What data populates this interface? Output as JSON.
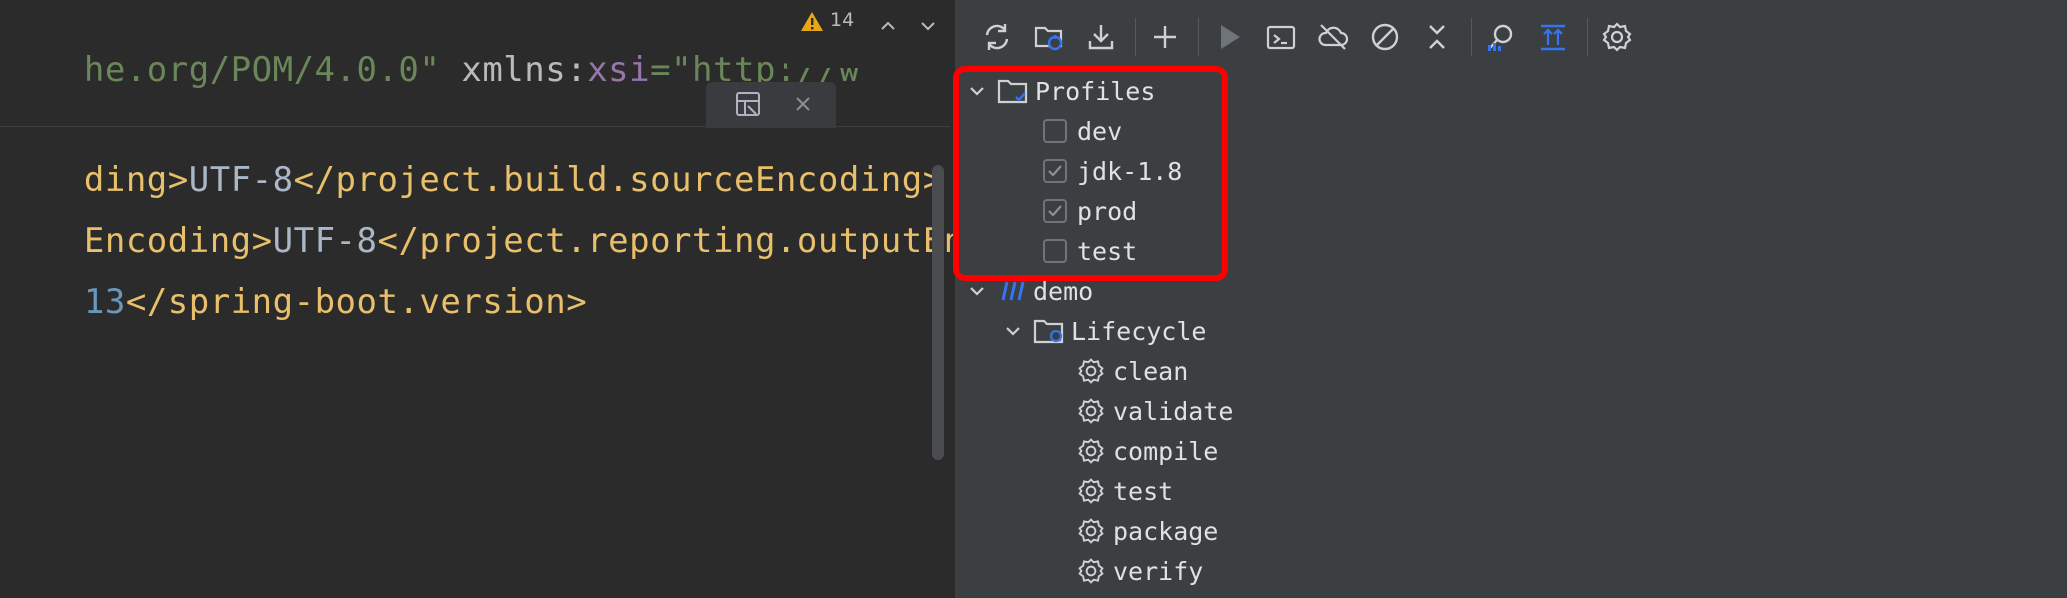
{
  "editor": {
    "line1": {
      "a": "he.org/POM/4.0.0\"",
      "b": " xmlns:",
      "c": "xsi",
      "d": "=\"http://w"
    },
    "line2": {
      "a": "ding>",
      "b": "UTF-8",
      "c": "</project.build.sourceEncoding>"
    },
    "line3": {
      "a": "Encoding>",
      "b": "UTF-8",
      "c": "</project.reporting.outputEncod"
    },
    "line4": {
      "a": "13",
      "b": "</spring-boot.version>"
    },
    "warning_count": "14",
    "tail_char": "n"
  },
  "icons": {
    "warning": "warning-icon",
    "up": "chevron-up-icon",
    "down": "chevron-down-icon",
    "reader": "reader-mode-icon",
    "close": "close-icon"
  },
  "toolbar": {
    "buttons": [
      "reload-icon",
      "reload-folder-icon",
      "download-icon",
      "add-icon",
      "run-icon",
      "run-config-icon",
      "offline-icon",
      "skip-tests-icon",
      "collapse-icon",
      "analyze-dependencies-icon",
      "expand-all-icon",
      "settings-icon"
    ]
  },
  "tree": {
    "profiles_label": "Profiles",
    "profiles": [
      {
        "label": "dev",
        "checked": false
      },
      {
        "label": "jdk-1.8",
        "checked": true
      },
      {
        "label": "prod",
        "checked": true
      },
      {
        "label": "test",
        "checked": false
      }
    ],
    "project_label": "demo",
    "lifecycle_label": "Lifecycle",
    "lifecycle": [
      "clean",
      "validate",
      "compile",
      "test",
      "package",
      "verify"
    ]
  },
  "colors": {
    "highlight": "#ff0000",
    "accent": "#3574f0",
    "warning": "#e6a817"
  }
}
